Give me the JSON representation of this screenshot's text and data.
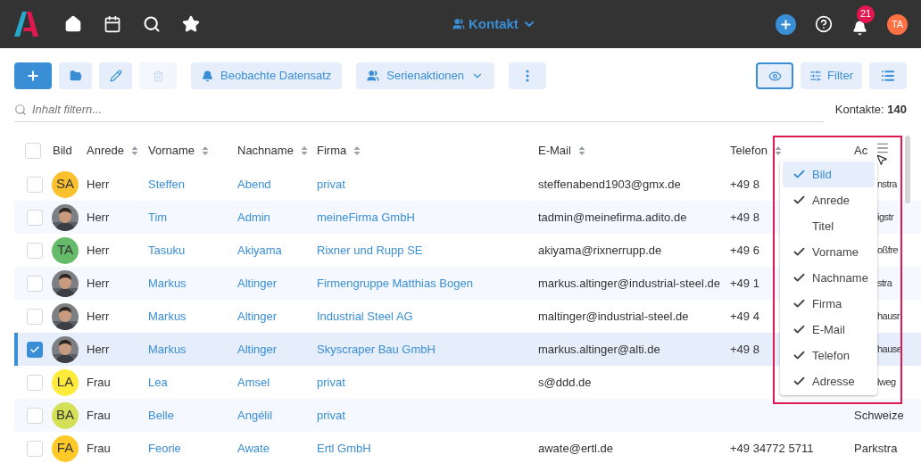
{
  "topbar": {
    "module": "Kontakt",
    "notifications": "21",
    "user_initials": "TA"
  },
  "toolbar": {
    "watch": "Beobachte Datensatz",
    "series": "Serienaktionen",
    "filter": "Filter",
    "view_active": true
  },
  "search": {
    "placeholder": "Inhalt filtern...",
    "count_label": "Kontakte:",
    "count": "140"
  },
  "table": {
    "all_selected": false,
    "columns": [
      {
        "label": "Bild",
        "sortable": false
      },
      {
        "label": "Anrede",
        "sortable": true
      },
      {
        "label": "Vorname",
        "sortable": true
      },
      {
        "label": "Nachname",
        "sortable": true
      },
      {
        "label": "Firma",
        "sortable": true
      },
      {
        "label": "E-Mail",
        "sortable": true
      },
      {
        "label": "Telefon",
        "sortable": true
      },
      {
        "label": "Ac",
        "sortable": false
      }
    ],
    "rows": [
      {
        "selected": false,
        "kind": "initials",
        "initials": "SA",
        "color": "#fbc02d",
        "salutation": "Herr",
        "first": "Steffen",
        "last": "Abend",
        "company": "privat",
        "email": "steffenabend1903@gmx.de",
        "phone": "+49 8",
        "address": "nstra"
      },
      {
        "selected": false,
        "salutation": "Herr",
        "first": "Tim",
        "last": "Admin",
        "company": "meineFirma GmbH",
        "email": "tadmin@meinefirma.adito.de",
        "phone": "+49 8",
        "address": "igstr"
      },
      {
        "selected": false,
        "kind": "initials",
        "initials": "TA",
        "color": "#66bb6a",
        "salutation": "Herr",
        "first": "Tasuku",
        "last": "Akiyama",
        "company": "Rixner und Rupp SE",
        "email": "akiyama@rixnerrupp.de",
        "phone": "+49 6",
        "address": "oßfre"
      },
      {
        "selected": false,
        "salutation": "Herr",
        "first": "Markus",
        "last": "Altinger",
        "company": "Firmengruppe Matthias Bogen",
        "email": "markus.altinger@industrial-steel.de",
        "phone": "+49 1",
        "address": "stra"
      },
      {
        "selected": false,
        "salutation": "Herr",
        "first": "Markus",
        "last": "Altinger",
        "company": "Industrial Steel AG",
        "email": "maltinger@industrial-steel.de",
        "phone": "+49 4",
        "address": "hausr"
      },
      {
        "selected": true,
        "salutation": "Herr",
        "first": "Markus",
        "last": "Altinger",
        "company": "Skyscraper Bau GmbH",
        "email": "markus.altinger@alti.de",
        "phone": "+49 8",
        "address": "hause"
      },
      {
        "selected": false,
        "kind": "initials",
        "initials": "LA",
        "color": "#ffeb3b",
        "salutation": "Frau",
        "first": "Lea",
        "last": "Amsel",
        "company": "privat",
        "email": "s@ddd.de",
        "address": "lweg"
      },
      {
        "selected": false,
        "kind": "initials",
        "initials": "BA",
        "color": "#d4e157",
        "salutation": "Frau",
        "first": "Belle",
        "last": "Angélil",
        "company": "privat",
        "address": "Schweize"
      },
      {
        "selected": false,
        "kind": "initials",
        "initials": "FA",
        "color": "#ffca28",
        "salutation": "Frau",
        "first": "Feorie",
        "last": "Awate",
        "company": "Ertl GmbH",
        "email": "awate@ertl.de",
        "phone": "+49 34772 5711",
        "address": "Parkstra"
      }
    ]
  },
  "column_menu": [
    {
      "label": "Bild",
      "checked": true,
      "selected": true
    },
    {
      "label": "Anrede",
      "checked": true,
      "selected": false
    },
    {
      "label": "Titel",
      "checked": false,
      "selected": false
    },
    {
      "label": "Vorname",
      "checked": true,
      "selected": false
    },
    {
      "label": "Nachname",
      "checked": true,
      "selected": false
    },
    {
      "label": "Firma",
      "checked": true,
      "selected": false
    },
    {
      "label": "E-Mail",
      "checked": true,
      "selected": false
    },
    {
      "label": "Telefon",
      "checked": true,
      "selected": false
    },
    {
      "label": "Adresse",
      "checked": true,
      "selected": false
    }
  ]
}
